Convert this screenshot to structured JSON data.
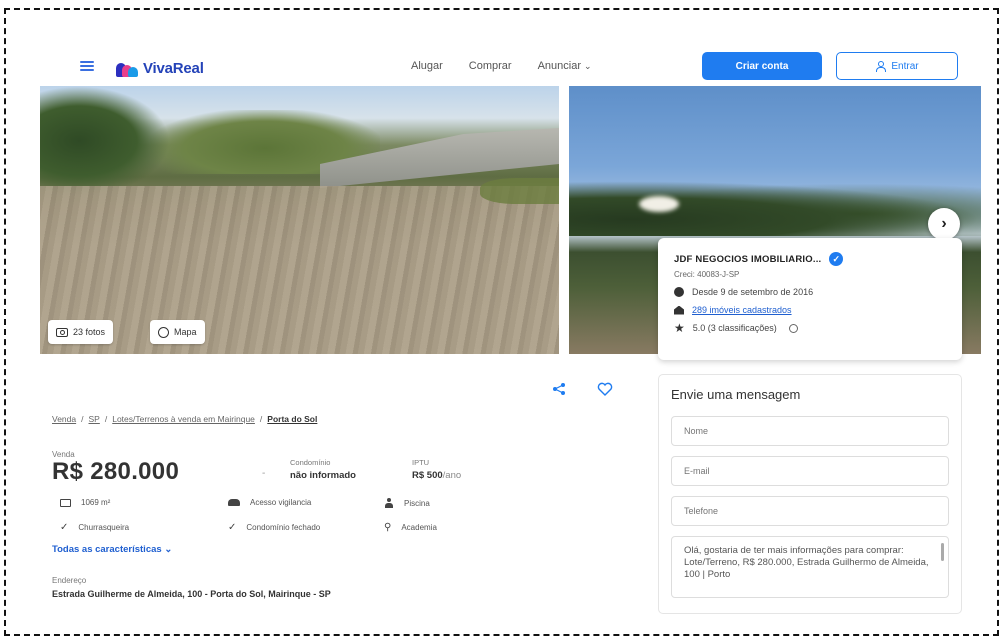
{
  "header": {
    "logo_text": "VivaReal",
    "nav": [
      {
        "label": "Alugar"
      },
      {
        "label": "Comprar"
      },
      {
        "label": "Anunciar"
      }
    ],
    "create_account_label": "Criar conta",
    "login_label": "Entrar",
    "accent_color": "#1f7cf0"
  },
  "gallery": {
    "photos_label": "23 fotos",
    "map_label": "Mapa"
  },
  "agency": {
    "name": "JDF NEGOCIOS IMOBILIARIO...",
    "creci": "Creci: 40083-J-SP",
    "since": "Desde 9 de setembro de 2016",
    "listings": "289 imóveis cadastrados",
    "rating": "5.0 (3 classificações)"
  },
  "message_form": {
    "title": "Envie uma mensagem",
    "name_placeholder": "Nome",
    "email_placeholder": "E-mail",
    "phone_placeholder": "Telefone",
    "message_text": "Olá, gostaria de ter mais informações para comprar: Lote/Terreno, R$ 280.000, Estrada Guilhermo de Almeida, 100 | Porto"
  },
  "breadcrumb": {
    "items": [
      "Venda",
      "SP",
      "Lotes/Terrenos à venda em Mairinque"
    ],
    "current": "Porta do Sol"
  },
  "listing": {
    "sale_label": "Venda",
    "price": "R$ 280.000",
    "condo_label": "Condomínio",
    "condo_value": "não informado",
    "iptu_label": "IPTU",
    "iptu_value": "R$ 500",
    "iptu_unit": "/ano",
    "features": [
      {
        "icon": "area-icon",
        "label": "1069 m²"
      },
      {
        "icon": "security-icon",
        "label": "Acesso vigilancia"
      },
      {
        "icon": "playground-icon",
        "label": "Piscina"
      },
      {
        "icon": "check-icon",
        "label": "Churrasqueira"
      },
      {
        "icon": "check-icon",
        "label": "Condomínio fechado"
      },
      {
        "icon": "dumbbell-icon",
        "label": "Academia"
      }
    ],
    "all_features_label": "Todas as características",
    "address_label": "Endereço",
    "address": "Estrada Guilherme de Almeida, 100 - Porta do Sol, Mairinque - SP"
  }
}
